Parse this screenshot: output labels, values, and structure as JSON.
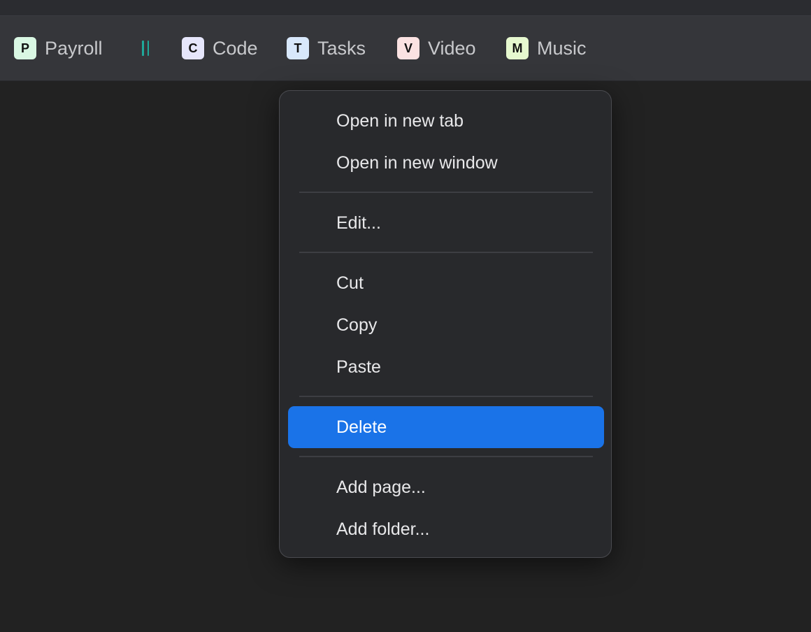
{
  "bookmarks": [
    {
      "initial": "P",
      "label": "Payroll",
      "badge_color": "#d9f7e3"
    },
    {
      "initial": "C",
      "label": "Code",
      "badge_color": "#e6e6fb"
    },
    {
      "initial": "T",
      "label": "Tasks",
      "badge_color": "#d8e8fb"
    },
    {
      "initial": "V",
      "label": "Video",
      "badge_color": "#fbe2e2"
    },
    {
      "initial": "M",
      "label": "Music",
      "badge_color": "#e6f8cf"
    }
  ],
  "separator_icon": {
    "name": "vertical-bars-icon",
    "color": "#1fa89a"
  },
  "context_menu": {
    "items": [
      {
        "label": "Open in new tab"
      },
      {
        "label": "Open in new window"
      },
      {
        "label": "Edit..."
      },
      {
        "label": "Cut"
      },
      {
        "label": "Copy"
      },
      {
        "label": "Paste"
      },
      {
        "label": "Delete",
        "selected": true
      },
      {
        "label": "Add page..."
      },
      {
        "label": "Add folder..."
      }
    ]
  },
  "colors": {
    "background": "#222222",
    "bar": "#35363a",
    "menu": "#28292c",
    "highlight": "#1a73e8",
    "text": "#e8e8ea"
  }
}
